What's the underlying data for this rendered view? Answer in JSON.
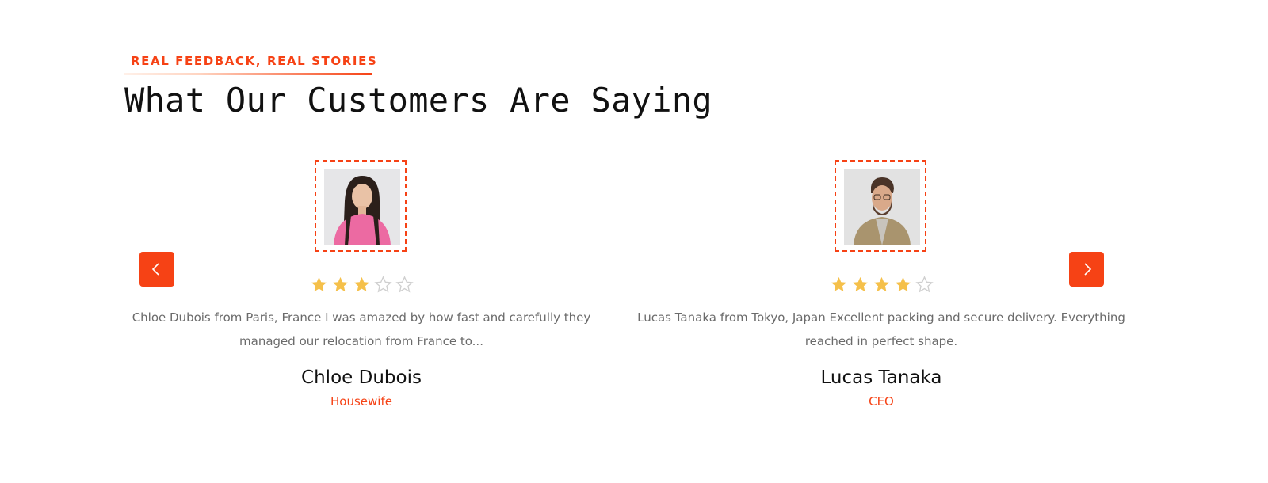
{
  "section": {
    "eyebrow": "REAL FEEDBACK, REAL STORIES",
    "title": "What Our Customers Are Saying"
  },
  "carousel": {
    "prev_icon": "chevron-left-icon",
    "next_icon": "chevron-right-icon"
  },
  "colors": {
    "accent": "#f64215",
    "star_filled": "#f5c04a",
    "star_empty": "#cfcfcf",
    "text_dark": "#111111",
    "text_muted": "#6b6b6b"
  },
  "testimonials": [
    {
      "name": "Chloe Dubois",
      "role": "Housewife",
      "rating": 3,
      "max_rating": 5,
      "quote": "Chloe Dubois from Paris, France I was amazed by how fast and carefully they managed our relocation from France to..."
    },
    {
      "name": "Lucas Tanaka",
      "role": "CEO",
      "rating": 4,
      "max_rating": 5,
      "quote": "Lucas Tanaka from Tokyo, Japan Excellent packing and secure delivery. Everything reached in perfect shape."
    }
  ]
}
